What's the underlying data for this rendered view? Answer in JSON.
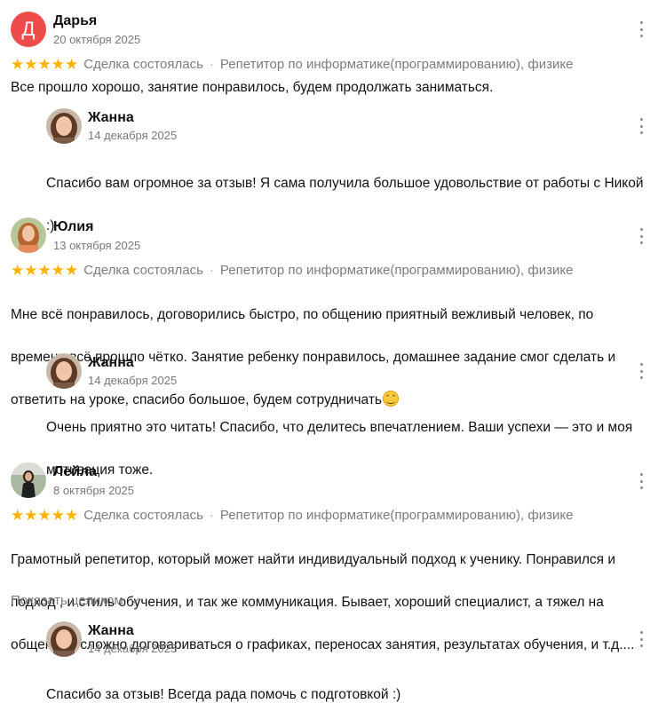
{
  "meta_prefix": "Сделка состоялась",
  "meta_separator": "·",
  "meta_category": "Репетитор по информатике(программированию), физике",
  "rating_stars": 5,
  "star_color": "#ffb300",
  "reviews": [
    {
      "author": "Дарья",
      "avatar_letter": "Д",
      "avatar_color": "#ee4b4b",
      "date": "20 октября 2025",
      "text": "Все прошло хорошо, занятие понравилось, будем продолжать заниматься.",
      "reply": {
        "author": "Жанна",
        "date": "14 декабря 2025",
        "text_line1": "Спасибо вам огромное за отзыв! Я сама получила большое удовольствие от работы с Никой",
        "text_line2": ":)"
      }
    },
    {
      "author": "Юлия",
      "date": "13 октября 2025",
      "text_line1": "Мне всё понравилось, договорились быстро, по общению приятный вежливый человек, по",
      "text_line2": "времени всё прошло чётко. Занятие ребенку понравилось, домашнее задание смог сделать и",
      "text_line3": "ответить на уроке, спасибо большое, будем сотрудничать",
      "emoji": "smiling-face-emoji",
      "reply": {
        "author": "Жанна",
        "date": "14 декабря 2025",
        "text_line1": "Очень приятно это читать! Спасибо, что делитесь впечатлением. Ваши успехи — это и моя",
        "text_line2": "мотивация тоже."
      }
    },
    {
      "author": "Лейла",
      "date": "8 октября 2025",
      "text_line1": "Грамотный репетитор, который может найти индивидуальный подход к ученику. Понравился и",
      "text_line2": "подход , и стиль обучения, и так же коммуникация. Бывает, хороший специалист, а тяжел на",
      "text_line3": "общение - сложно договариваться о графиках, переносах занятия, результатах обучения, и т.д....",
      "expand_label": "Показать целиком",
      "reply": {
        "author": "Жанна",
        "date": "14 декабря 2025",
        "text_line1": "Спасибо за отзыв! Всегда рада помочь с подготовкой :)"
      }
    }
  ]
}
